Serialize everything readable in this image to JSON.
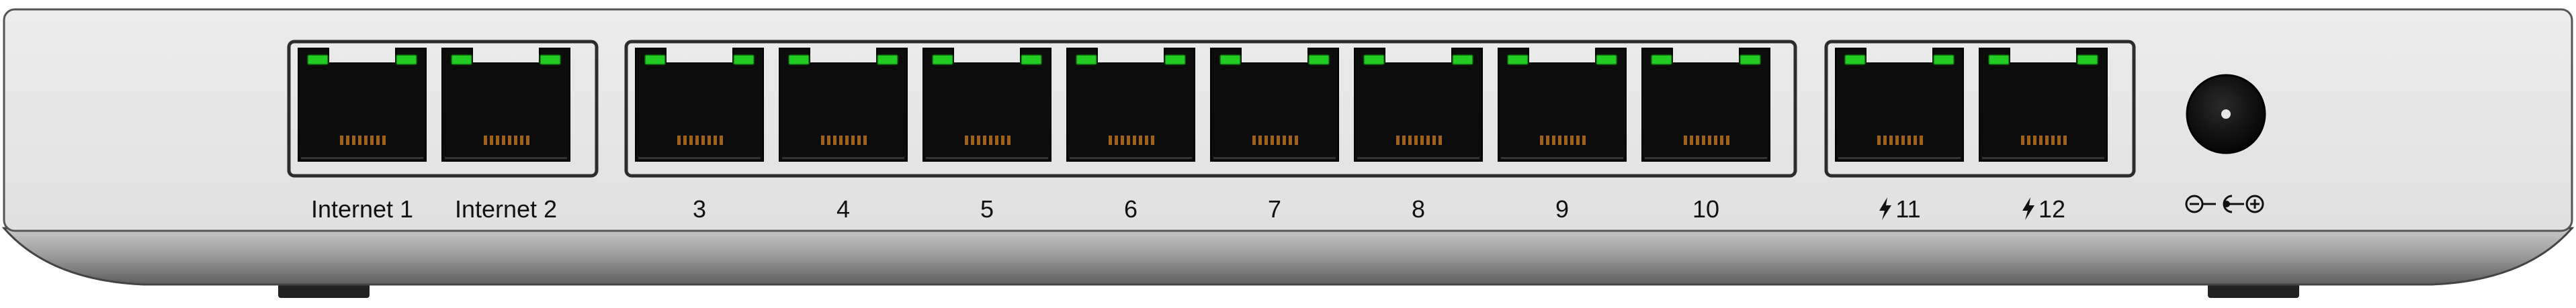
{
  "device": {
    "name": "",
    "chassis_color": "#e6e6e6",
    "led_color": "#22cc22",
    "port_body_color": "#0c0c0c",
    "pin_color": "#a0621a"
  },
  "port_groups": [
    {
      "id": "internet",
      "ports": [
        {
          "label": "Internet 1",
          "poe": false
        },
        {
          "label": "Internet 2",
          "poe": false
        }
      ]
    },
    {
      "id": "lan",
      "ports": [
        {
          "label": "3",
          "poe": false
        },
        {
          "label": "4",
          "poe": false
        },
        {
          "label": "5",
          "poe": false
        },
        {
          "label": "6",
          "poe": false
        },
        {
          "label": "7",
          "poe": false
        },
        {
          "label": "8",
          "poe": false
        },
        {
          "label": "9",
          "poe": false
        },
        {
          "label": "10",
          "poe": false
        }
      ]
    },
    {
      "id": "poe",
      "ports": [
        {
          "label": "11",
          "poe": true,
          "icon": "lightning-bolt-icon"
        },
        {
          "label": "12",
          "poe": true,
          "icon": "lightning-bolt-icon"
        }
      ]
    }
  ],
  "power": {
    "icon": "dc-polarity-icon",
    "jack_icon": "dc-power-jack-icon"
  }
}
